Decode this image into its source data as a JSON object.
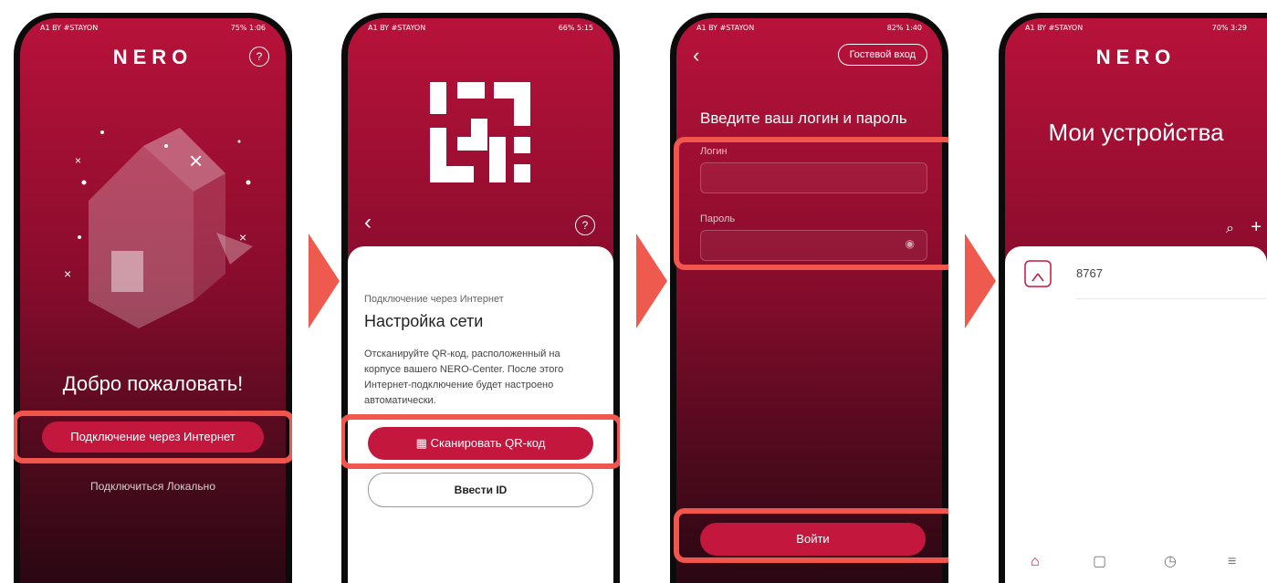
{
  "screen1": {
    "status_left": "A1 BY #STAYON",
    "status_right": "75% 1:06",
    "logo": "NERO",
    "help": "?",
    "welcome": "Добро пожаловать!",
    "internet_button": "Подключение через Интернет",
    "local_link": "Подключиться Локально"
  },
  "screen2": {
    "status_left": "A1 BY #STAYON",
    "status_right": "66% 5:15",
    "back": "‹",
    "help": "?",
    "subtitle": "Подключение через Интернет",
    "title": "Настройка сети",
    "description": "Отсканируйте QR-код, расположенный на корпусе вашего NERO-Center. После этого Интернет-подключение будет настроено автоматически.",
    "scan_button": "Сканировать QR-код",
    "enter_id_button": "Ввести ID"
  },
  "screen3": {
    "status_left": "A1 BY #STAYON",
    "status_right": "82% 1:40",
    "back": "‹",
    "guest_button": "Гостевой вход",
    "heading": "Введите ваш логин и пароль",
    "login_label": "Логин",
    "login_value": "",
    "password_label": "Пароль",
    "password_value": "",
    "submit_button": "Войти"
  },
  "screen4": {
    "status_left": "A1 BY #STAYON",
    "status_right": "70% 3:29",
    "logo": "NERO",
    "title": "Мои устройства",
    "search": "⌕",
    "add": "+",
    "devices": [
      {
        "name": "8767"
      }
    ]
  },
  "colors": {
    "accent": "#c3173d",
    "highlight": "#f0564c"
  }
}
